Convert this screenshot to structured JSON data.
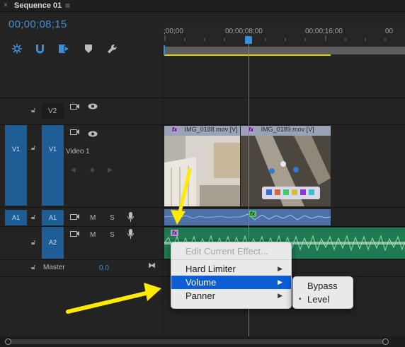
{
  "tab": {
    "close": "×",
    "title": "Sequence 01",
    "menu": "≡"
  },
  "timecode": "00;00;08;15",
  "ruler": {
    "labels": [
      ";00;00",
      "00;00;08;00",
      "00;00;16;00",
      "00"
    ]
  },
  "tracks": {
    "v2": {
      "label": "V2"
    },
    "v1": {
      "source": "V1",
      "label": "V1",
      "name": "Video 1"
    },
    "a1": {
      "source": "A1",
      "label": "A1",
      "m": "M",
      "s": "S"
    },
    "a2": {
      "label": "A2",
      "m": "M",
      "s": "S"
    },
    "master": {
      "label": "Master",
      "value": "0.0"
    }
  },
  "clips": {
    "v1a": {
      "name": "IMG_0188.mov [V]",
      "fx": "fx"
    },
    "v1b": {
      "name": "IMG_0189.mov [V]",
      "fx": "fx"
    },
    "a1fx": "fx",
    "a2fx": "fx"
  },
  "context_menu": {
    "items": [
      "Edit Current Effect...",
      "Hard Limiter",
      "Volume",
      "Panner"
    ],
    "highlighted": "Volume"
  },
  "submenu": {
    "items": [
      "Bypass",
      "Level"
    ],
    "checked": "Level",
    "bullet": "•"
  },
  "colors": {
    "accent": "#3a8fd9",
    "target": "#1f5d96",
    "audio_clip": "#1f7a52",
    "arrow": "#ffea00"
  }
}
